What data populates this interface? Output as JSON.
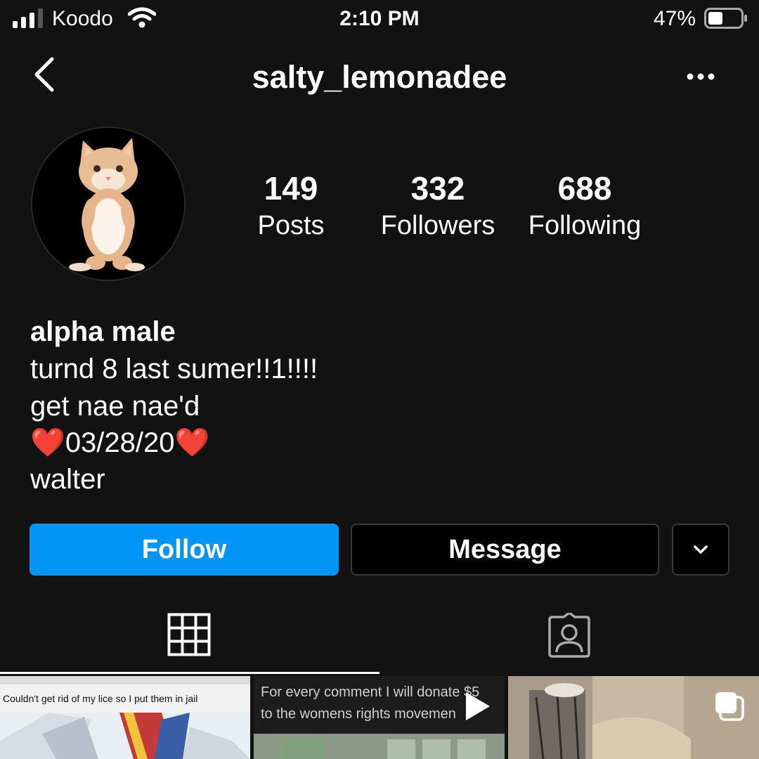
{
  "status_bar": {
    "carrier": "Koodo",
    "time": "2:10 PM",
    "battery": "47%"
  },
  "nav": {
    "username": "salty_lemonadee"
  },
  "stats": [
    {
      "value": "149",
      "label": "Posts"
    },
    {
      "value": "332",
      "label": "Followers"
    },
    {
      "value": "688",
      "label": "Following"
    }
  ],
  "bio": {
    "name": "alpha male",
    "line1": "turnd 8 last sumer!!1!!!!",
    "line2": "get nae nae'd",
    "line3_heart_left": "❤️",
    "line3_date": "03/28/20",
    "line3_heart_right": "❤️",
    "line4": "walter"
  },
  "actions": {
    "follow_label": "Follow",
    "message_label": "Message"
  },
  "tabs": [
    {
      "name": "grid",
      "icon": "grid-icon",
      "active": true
    },
    {
      "name": "tagged",
      "icon": "tagged-person-icon",
      "active": false
    }
  ],
  "posts": [
    {
      "caption": "Couldn't get rid of my lice so I put them in jail",
      "type": "image"
    },
    {
      "caption_line1": "For every comment I will donate $5",
      "caption_line2": "to the womens rights movemen",
      "type": "video",
      "icon": "play-icon"
    },
    {
      "type": "carousel",
      "icon": "carousel-icon"
    }
  ],
  "colors": {
    "background": "#121212",
    "follow_button": "#0095f6",
    "text": "#ffffff"
  }
}
